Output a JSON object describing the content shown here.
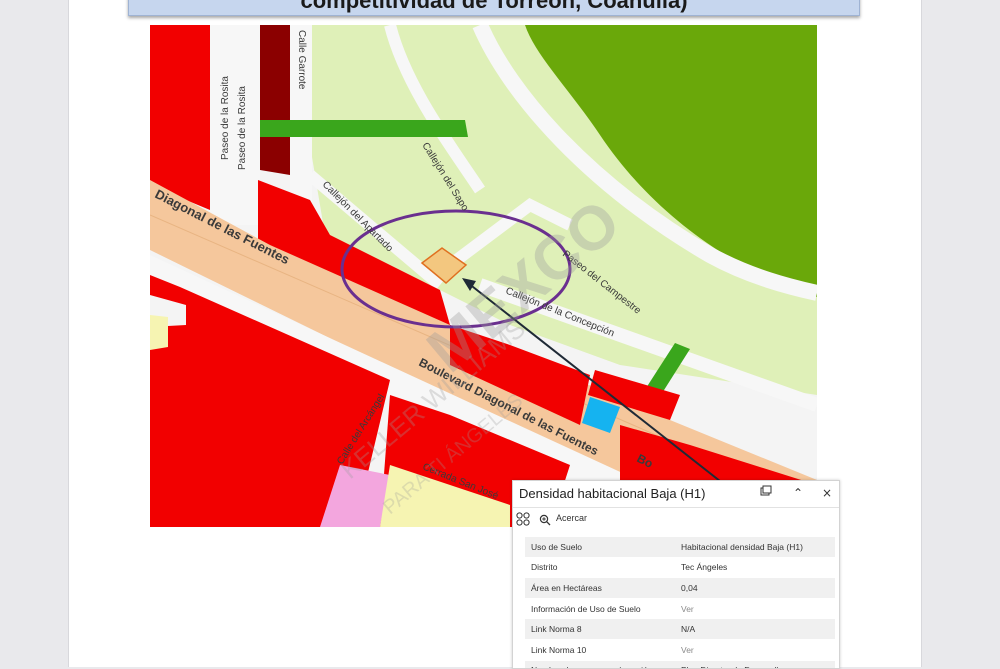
{
  "banner": {
    "title": "competitividad de Torreón, Coahuila)"
  },
  "map": {
    "streets": {
      "calle_garrote": "Calle Garrote",
      "paseo_rosita_1": "Paseo de la Rosita",
      "paseo_rosita_2": "Paseo de la Rosita",
      "callejon_sapo": "Callejón del Sapo",
      "callejon_apartado": "Callejón del Apartado",
      "diagonal_fuentes": "Diagonal de las Fuentes",
      "paseo_campestre": "Paseo del Campestre",
      "callejon_concepcion": "Callejón de la Concepción",
      "boulevard": "Boulevard Diagonal de las Fuentes",
      "bo_fragment": "Bo",
      "calle_arcangel": "Calle del Arcángel",
      "cerrada_san_jose": "Cerrada San José"
    },
    "watermark": {
      "brand": "MEXCO",
      "agency": "KELLER WILLIAMS",
      "sub": "PARA TI ÁNGELES"
    },
    "colors": {
      "commercial": "#f20000",
      "dark_red": "#8b0000",
      "residential_light": "#dff0b8",
      "park": "#6aa80a",
      "green_strip": "#3aa61c",
      "road_main": "#f5c79c",
      "water_blue": "#15b3f0",
      "pink": "#f3a6de",
      "yellow": "#f6f4b2",
      "selected_lot": "#f3c77f",
      "circle": "#6a2f8f"
    }
  },
  "popup": {
    "title": "Densidad habitacional Baja (H1)",
    "zoom_label": "Acercar",
    "rows": [
      {
        "key": "Uso de Suelo",
        "value": "Habitacional densidad Baja (H1)"
      },
      {
        "key": "Distrito",
        "value": "Tec Ángeles"
      },
      {
        "key": "Área en Hectáreas",
        "value": "0,04"
      },
      {
        "key": "Información de Uso de Suelo",
        "value": "Ver"
      },
      {
        "key": "Link Norma 8",
        "value": "N/A"
      },
      {
        "key": "Link Norma 10",
        "value": "Ver"
      },
      {
        "key": "Nombre de programa y/o sesión",
        "value": "Plan Director de Desarrollo"
      }
    ]
  }
}
